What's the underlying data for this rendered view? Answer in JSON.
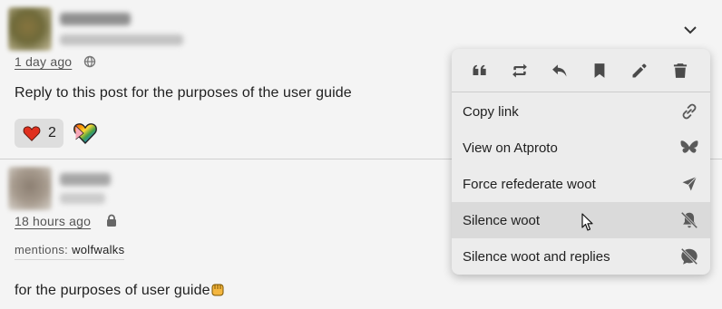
{
  "post1": {
    "time": "1 day ago",
    "text": "Reply to this post for the purposes of the user guide",
    "reaction_count": "2"
  },
  "post2": {
    "time": "18 hours ago",
    "mentions_label": "mentions:",
    "mentions_user": "wolfwalks",
    "text": "for the purposes of user guide"
  },
  "menu": {
    "toolbar": [
      "quote-icon",
      "boost-icon",
      "reply-icon",
      "bookmark-icon",
      "edit-icon",
      "delete-icon"
    ],
    "items": [
      {
        "label": "Copy link",
        "icon": "link-icon"
      },
      {
        "label": "View on Atproto",
        "icon": "butterfly-icon"
      },
      {
        "label": "Force refederate woot",
        "icon": "send-icon"
      },
      {
        "label": "Silence woot",
        "icon": "bell-off-icon"
      },
      {
        "label": "Silence woot and replies",
        "icon": "chat-off-icon"
      }
    ]
  }
}
